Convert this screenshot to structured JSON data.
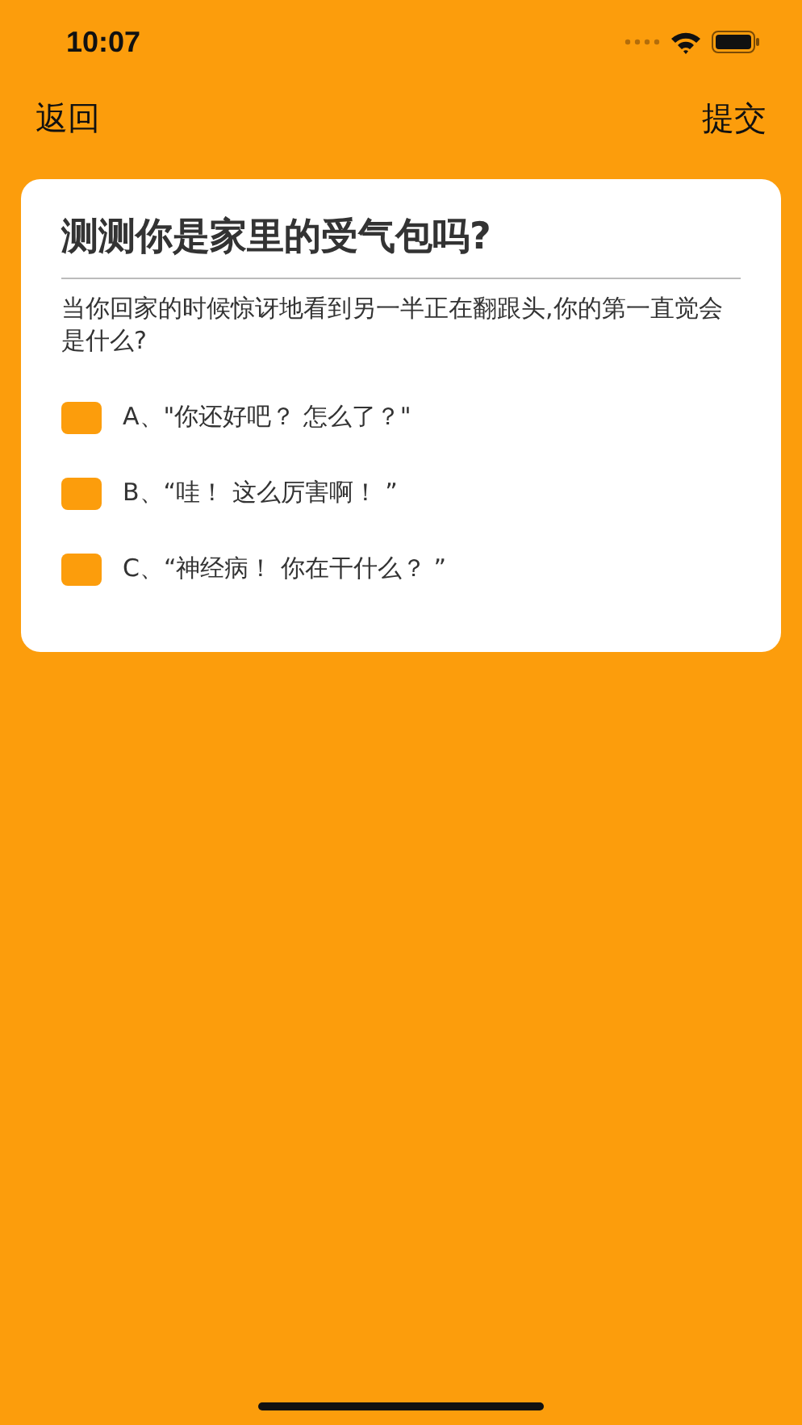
{
  "status_bar": {
    "time": "10:07"
  },
  "nav": {
    "back": "返回",
    "submit": "提交"
  },
  "quiz": {
    "title": "测测你是家里的受气包吗?",
    "question": "当你回家的时候惊讶地看到另一半正在翻跟头,你的第一直觉会是什么?",
    "options": [
      {
        "label": "A、\"你还好吧？ 怎么了？\"",
        "checked": false
      },
      {
        "label": "B、“哇！ 这么厉害啊！ ”",
        "checked": false
      },
      {
        "label": "C、“神经病！ 你在干什么？ ”",
        "checked": false
      }
    ]
  }
}
